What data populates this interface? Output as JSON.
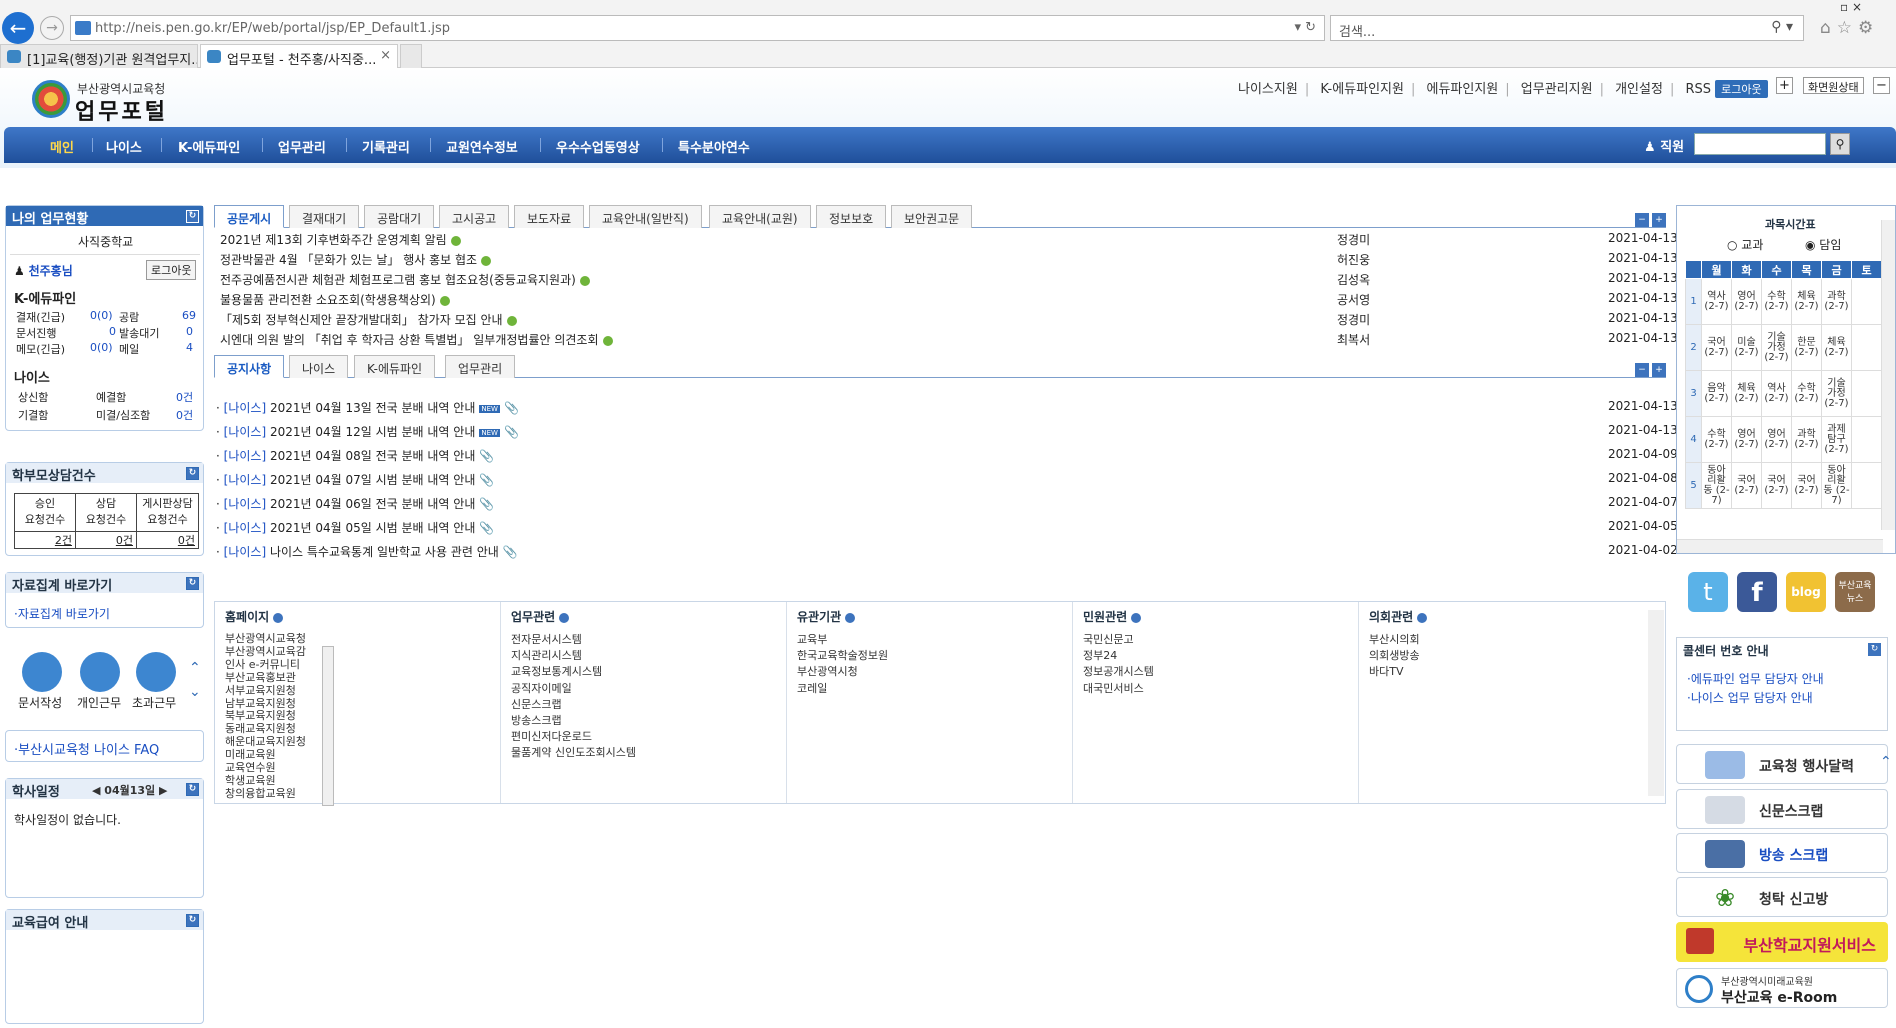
{
  "browser": {
    "url": "http://neis.pen.go.kr/EP/web/portal/jsp/EP_Default1.jsp",
    "search_placeholder": "검색...",
    "tabs": [
      {
        "label": "[1]교육(행정)기관 원격업무지..."
      },
      {
        "label": "업무포털 - 천주홍/사직중..."
      }
    ]
  },
  "header": {
    "org": "부산광역시교육청",
    "title": "업무포털",
    "top_links": [
      "나이스지원",
      "K-에듀파인지원",
      "에듀파인지원",
      "업무관리지원",
      "개인설정",
      "RSS"
    ],
    "logout": "로그아웃",
    "screen_btn": "화면원상태"
  },
  "nav": {
    "items": [
      "메인",
      "나이스",
      "K-에듀파인",
      "업무관리",
      "기록관리",
      "교원연수정보",
      "우수수업동영상",
      "특수분야연수"
    ],
    "staff_label": "직원"
  },
  "mywork": {
    "title": "나의 업무현황",
    "school": "사직중학교",
    "user": "천주홍님",
    "logout": "로그아웃",
    "edufine_title": "K-에듀파인",
    "rows": [
      [
        "결재(긴급)",
        "0(0)",
        "공람",
        "69"
      ],
      [
        "문서진행",
        "0",
        "발송대기",
        "0"
      ],
      [
        "메모(긴급)",
        "0(0)",
        "메일",
        "4"
      ]
    ],
    "neis_title": "나이스",
    "neis_rows": [
      [
        "상신함",
        "예결함",
        "0건"
      ],
      [
        "기결함",
        "미결/심조함",
        "0건"
      ]
    ]
  },
  "consult": {
    "title": "학부모상담건수",
    "headers": [
      [
        "승인",
        "요청건수"
      ],
      [
        "상담",
        "요청건수"
      ],
      [
        "게시판상담",
        "요청건수"
      ]
    ],
    "values": [
      "2건",
      "0건",
      "0건"
    ]
  },
  "datacollect": {
    "title": "자료집계 바로가기",
    "link": "·자료집계 바로가기"
  },
  "quick": [
    "문서작성",
    "개인근무",
    "초과근무"
  ],
  "faq": "·부산시교육청 나이스 FAQ",
  "schedule": {
    "title": "학사일정",
    "date": "04월13일",
    "empty": "학사일정이 없습니다."
  },
  "edupay": {
    "title": "교육급여 안내"
  },
  "board_tabs": [
    "공문게시",
    "결재대기",
    "공람대기",
    "고시공고",
    "보도자료",
    "교육안내(일반직)",
    "교육안내(교원)",
    "정보보호",
    "보안권고문"
  ],
  "board_rows": [
    {
      "title": "2021년 제13회 기후변화주간 운영계획 알림",
      "author": "정경미",
      "date": "2021-04-13"
    },
    {
      "title": "정관박물관 4월 「문화가 있는 날」 행사 홍보 협조",
      "author": "허진웅",
      "date": "2021-04-13"
    },
    {
      "title": "전주공예품전시관 체험관 체험프로그램 홍보 협조요청(중등교육지원과)",
      "author": "김성옥",
      "date": "2021-04-13"
    },
    {
      "title": "불용물품 관리전환 소요조회(학생용책상외)",
      "author": "공서영",
      "date": "2021-04-13"
    },
    {
      "title": "「제5회 정부혁신제안 끝장개발대회」 참가자 모집 안내",
      "author": "정경미",
      "date": "2021-04-13"
    },
    {
      "title": "시엔대 의원 발의 「취업 후 학자금 상환 특별법」 일부개정법률안 의견조회",
      "author": "최복서",
      "date": "2021-04-13"
    }
  ],
  "notice_tabs": [
    "공지사항",
    "나이스",
    "K-에듀파인",
    "업무관리"
  ],
  "notice_rows": [
    {
      "tag": "[나이스]",
      "title": "2021년 04월 13일 전국 분배 내역 안내",
      "date": "2021-04-13",
      "new": true
    },
    {
      "tag": "[나이스]",
      "title": "2021년 04월 12일 시범 분배 내역 안내",
      "date": "2021-04-13",
      "new": true
    },
    {
      "tag": "[나이스]",
      "title": "2021년 04월 08일 전국 분배 내역 안내",
      "date": "2021-04-09",
      "new": false
    },
    {
      "tag": "[나이스]",
      "title": "2021년 04월 07일 시범 분배 내역 안내",
      "date": "2021-04-08",
      "new": false
    },
    {
      "tag": "[나이스]",
      "title": "2021년 04월 06일 전국 분배 내역 안내",
      "date": "2021-04-07",
      "new": false
    },
    {
      "tag": "[나이스]",
      "title": "2021년 04월 05일 시범 분배 내역 안내",
      "date": "2021-04-05",
      "new": false
    },
    {
      "tag": "[나이스]",
      "title": "나이스 특수교육통계 일반학교 사용 관련 안내",
      "date": "2021-04-02",
      "new": false
    }
  ],
  "links": [
    {
      "title": "홈페이지",
      "items": [
        "부산광역시교육청",
        "부산광역시교육감",
        "인사 e-커뮤니티",
        "부산교육홍보관",
        "서부교육지원청",
        "남부교육지원청",
        "북부교육지원청",
        "동래교육지원청",
        "해운대교육지원청",
        "미래교육원",
        "교육연수원",
        "학생교육원",
        "창의융합교육원"
      ]
    },
    {
      "title": "업무관련",
      "items": [
        "전자문서시스템",
        "지식관리시스템",
        "교육정보통계시스템",
        "공직자이메일",
        "신문스크랩",
        "방송스크랩",
        "편미신저다운로드",
        "물품계약 신인도조회시스템"
      ]
    },
    {
      "title": "유관기관",
      "items": [
        "교육부",
        "한국교육학술정보원",
        "부산광역시청",
        "코레일"
      ]
    },
    {
      "title": "민원관련",
      "items": [
        "국민신문고",
        "정부24",
        "정보공개시스템",
        "대국민서비스"
      ]
    },
    {
      "title": "의회관련",
      "items": [
        "부산시의회",
        "의회생방송",
        "바다TV"
      ]
    }
  ],
  "timetable": {
    "title": "과목시간표",
    "opt1": "교과",
    "opt2": "담임",
    "days": [
      "월",
      "화",
      "수",
      "목",
      "금",
      "토"
    ],
    "rows": [
      [
        "1",
        "역사 (2-7)",
        "영어 (2-7)",
        "수학 (2-7)",
        "체육 (2-7)",
        "과학 (2-7)",
        ""
      ],
      [
        "2",
        "국어 (2-7)",
        "미술 (2-7)",
        "기술 가정 (2-7)",
        "한문 (2-7)",
        "체육 (2-7)",
        ""
      ],
      [
        "3",
        "음악 (2-7)",
        "체육 (2-7)",
        "역사 (2-7)",
        "수학 (2-7)",
        "기술 가정 (2-7)",
        ""
      ],
      [
        "4",
        "수학 (2-7)",
        "영어 (2-7)",
        "영어 (2-7)",
        "과학 (2-7)",
        "과제 탐구 (2-7)",
        ""
      ],
      [
        "5",
        "동아 리활 동 (2-7)",
        "국어 (2-7)",
        "국어 (2-7)",
        "국어 (2-7)",
        "동아 리활 동 (2-7)",
        ""
      ]
    ]
  },
  "social": {
    "blog": "blog",
    "news": "부산교육 뉴스"
  },
  "callcenter": {
    "title": "콜센터 번호 안내",
    "items": [
      "·에듀파인 업무 담당자 안내",
      "·나이스 업무 담당자 안내"
    ]
  },
  "rlinks": [
    "교육청 행사달력",
    "신문스크랩",
    "방송 스크랩",
    "청탁 신고방"
  ],
  "banner1": "부산학교지원서비스",
  "banner2": {
    "sub": "부산광역시미래교육원",
    "main": "부산교육 e-Room"
  }
}
